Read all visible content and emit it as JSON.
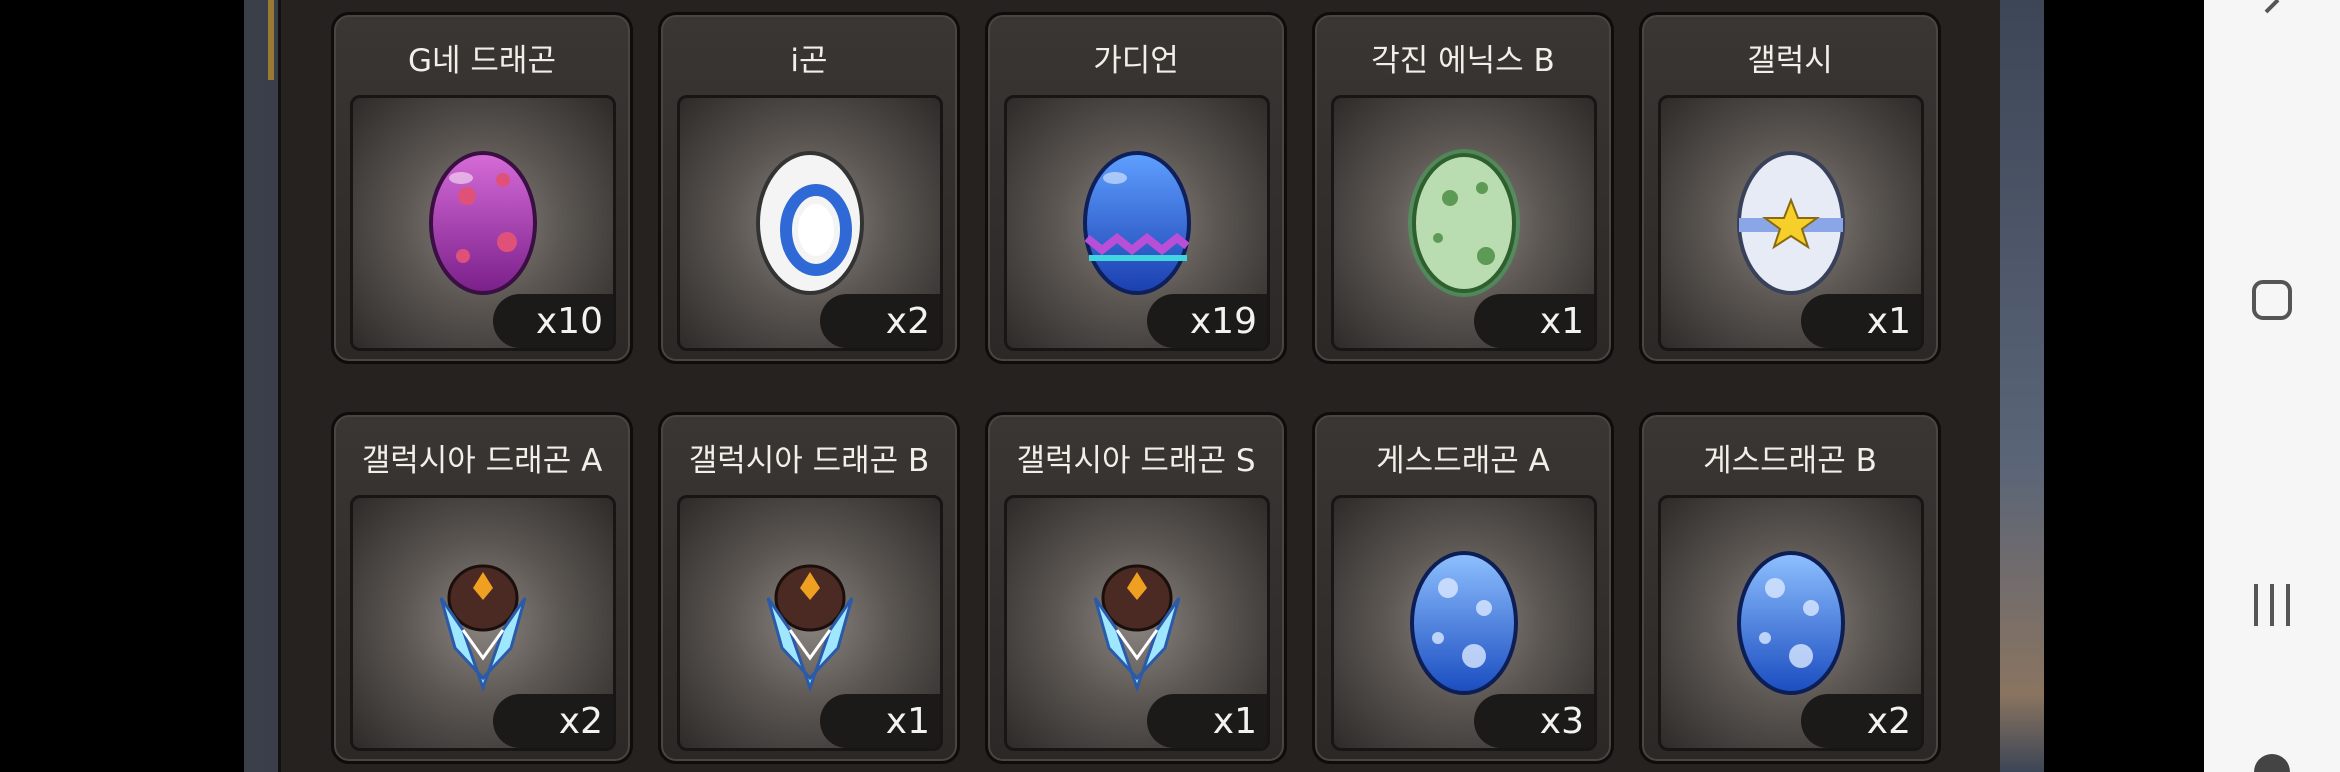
{
  "inventory": {
    "items": [
      {
        "name": "G네 드래곤",
        "qty": "x10",
        "icon": "purple-spotted-egg-icon"
      },
      {
        "name": "i곤",
        "qty": "x2",
        "icon": "white-ring-egg-icon"
      },
      {
        "name": "가디언",
        "qty": "x19",
        "icon": "blue-zigzag-egg-icon"
      },
      {
        "name": "각진 에닉스 B",
        "qty": "x1",
        "icon": "green-glowing-egg-icon"
      },
      {
        "name": "갤럭시",
        "qty": "x1",
        "icon": "star-belt-egg-icon"
      },
      {
        "name": "갤럭시아 드래곤 A",
        "qty": "x2",
        "icon": "crystal-crest-egg-icon"
      },
      {
        "name": "갤럭시아 드래곤 B",
        "qty": "x1",
        "icon": "crystal-crest-egg-icon"
      },
      {
        "name": "갤럭시아 드래곤 S",
        "qty": "x1",
        "icon": "crystal-crest-egg-icon"
      },
      {
        "name": "게스드래곤 A",
        "qty": "x3",
        "icon": "blue-cloud-egg-icon"
      },
      {
        "name": "게스드래곤 B",
        "qty": "x2",
        "icon": "blue-cloud-egg-icon"
      }
    ]
  },
  "navbar": {
    "icons": [
      "back-icon",
      "home-icon",
      "recents-icon",
      "info-icon"
    ]
  }
}
